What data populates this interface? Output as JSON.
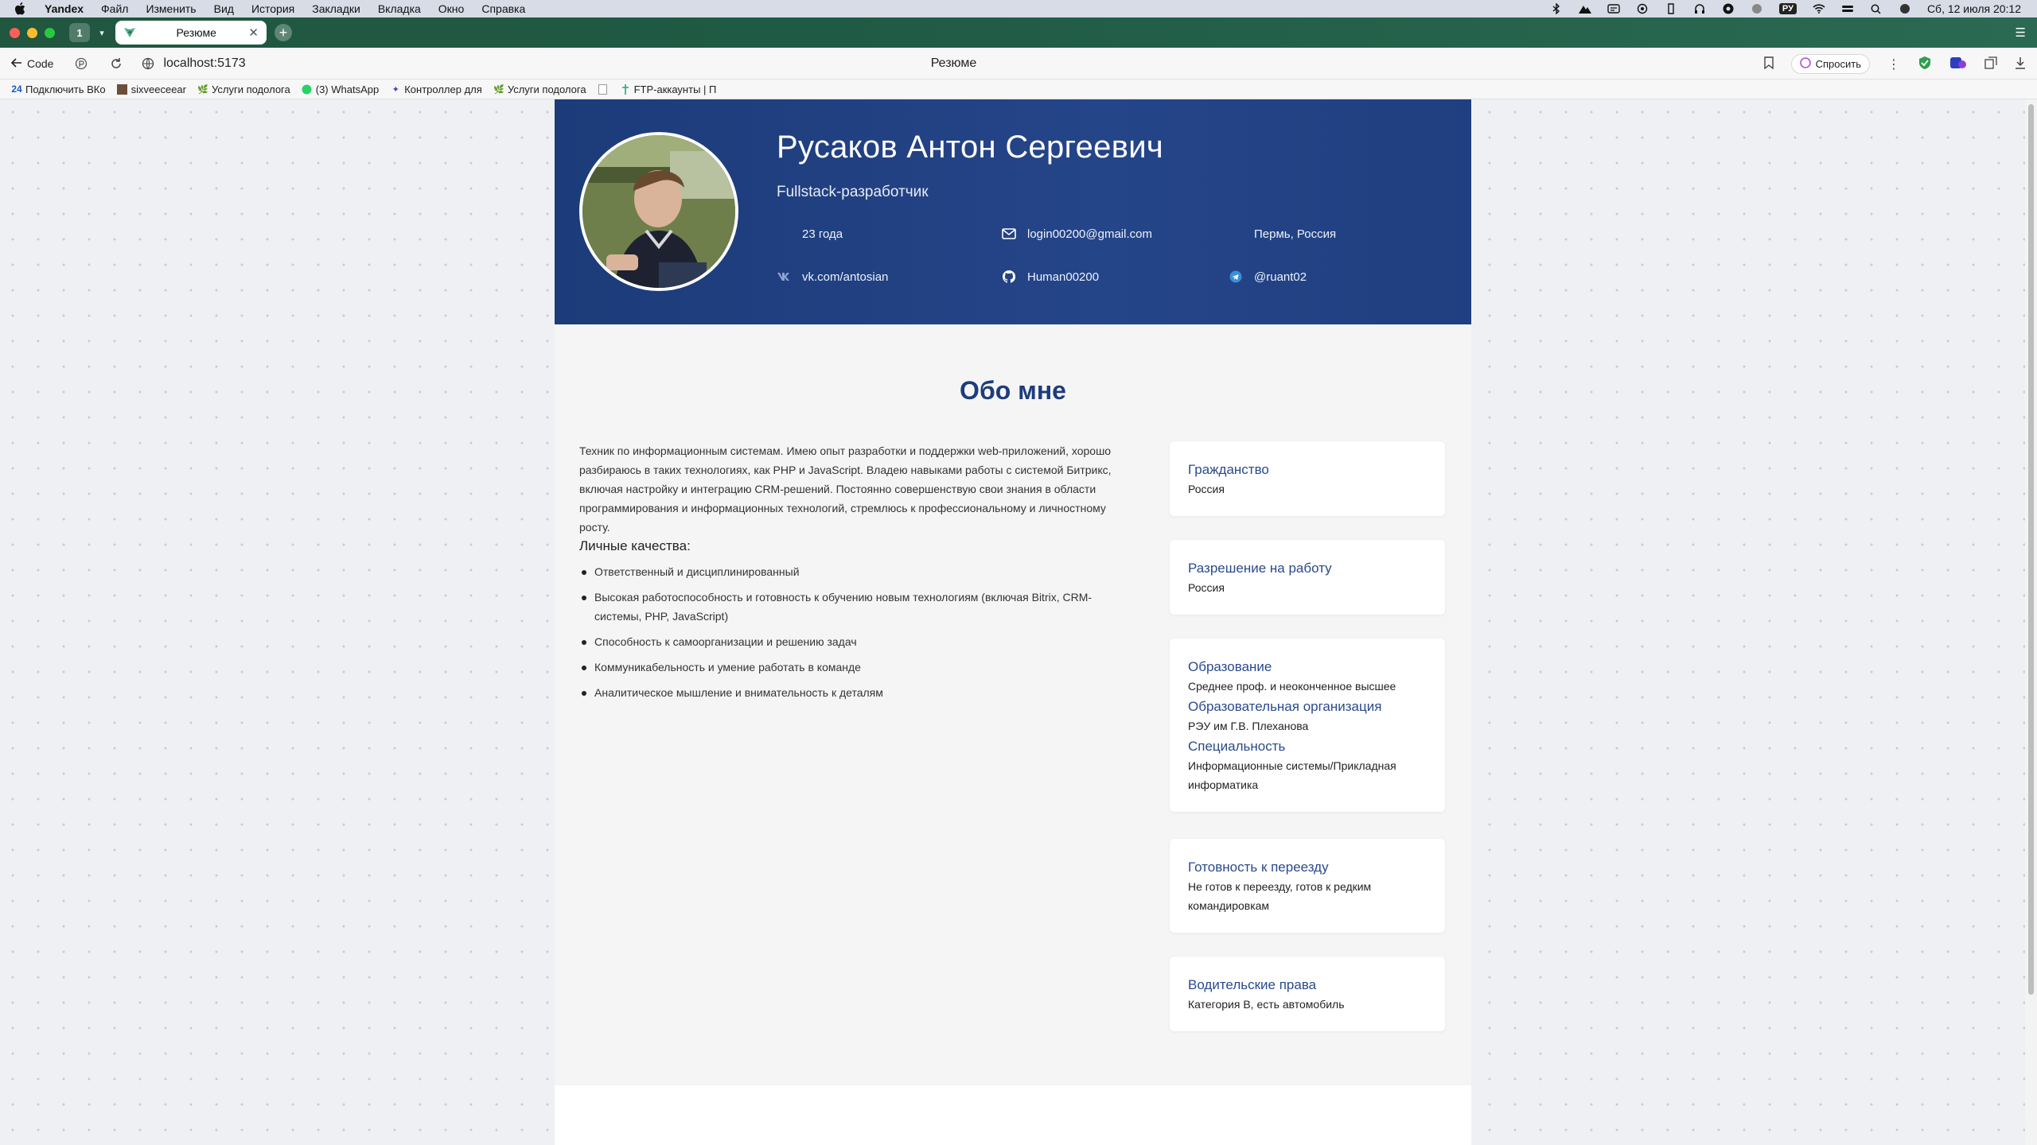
{
  "menubar": {
    "app_name": "Yandex",
    "items": [
      "Файл",
      "Изменить",
      "Вид",
      "История",
      "Закладки",
      "Вкладка",
      "Окно",
      "Справка"
    ],
    "lang": "РУ",
    "datetime": "Сб, 12 июля  20:12"
  },
  "tabs": {
    "count": "1",
    "active_title": "Резюме"
  },
  "address": {
    "back_label": "Code",
    "url": "localhost:5173",
    "page_title": "Резюме",
    "ask_label": "Спросить"
  },
  "bookmarks": [
    {
      "label": "Подключить ВКо",
      "icon": "24-icon"
    },
    {
      "label": "sixveeceear",
      "icon": "image-icon"
    },
    {
      "label": "Услуги подолога",
      "icon": "leaf-icon"
    },
    {
      "label": "(3) WhatsApp",
      "icon": "whatsapp-icon"
    },
    {
      "label": "Контроллер для",
      "icon": "star-icon"
    },
    {
      "label": "Услуги подолога",
      "icon": "leaf-icon"
    },
    {
      "label": "",
      "icon": "page-icon"
    },
    {
      "label": "FTP-аккаунты | П",
      "icon": "ftp-icon"
    }
  ],
  "profile": {
    "name": "Русаков Антон Сергеевич",
    "role": "Fullstack-разработчик",
    "age": "23 года",
    "email": "login00200@gmail.com",
    "location": "Пермь, Россия",
    "vk": "vk.com/antosian",
    "github": "Human00200",
    "telegram": "@ruant02"
  },
  "about": {
    "title": "Обо мне",
    "text": "Техник по информационным системам. Имею опыт разработки и поддержки web-приложений, хорошо разбираюсь в таких технологиях, как PHP и JavaScript. Владею навыками работы с системой Битрикс, включая настройку и интеграцию CRM-решений. Постоянно совершенствую свои знания в области программирования и информационных технологий, стремлюсь к профессиональному и личностному росту.",
    "qualities_title": "Личные качества:",
    "qualities": [
      "Ответственный и дисциплинированный",
      "Высокая работоспособность и готовность к обучению новым технологиям (включая Bitrix, CRM-системы, PHP, JavaScript)",
      "Способность к самоорганизации и решению задач",
      "Коммуникабельность и умение работать в команде",
      "Аналитическое мышление и внимательность к деталям"
    ]
  },
  "cards": {
    "citizenship": {
      "label": "Гражданство",
      "value": "Россия"
    },
    "work_permit": {
      "label": "Разрешение на работу",
      "value": "Россия"
    },
    "education": {
      "label": "Образование",
      "value": "Среднее проф. и неоконченное высшее",
      "org_label": "Образовательная организация",
      "org_value": "РЭУ им Г.В. Плеханова",
      "spec_label": "Специальность",
      "spec_value": "Информационные системы/Прикладная информатика"
    },
    "relocation": {
      "label": "Готовность к переезду",
      "value": "Не готов к переезду, готов к редким командировкам"
    },
    "license": {
      "label": "Водительские права",
      "value": "Категория B, есть автомобиль"
    }
  },
  "colors": {
    "hero": "#1f3f80",
    "accent": "#2a4a8c",
    "tabstrip": "#21563f"
  }
}
